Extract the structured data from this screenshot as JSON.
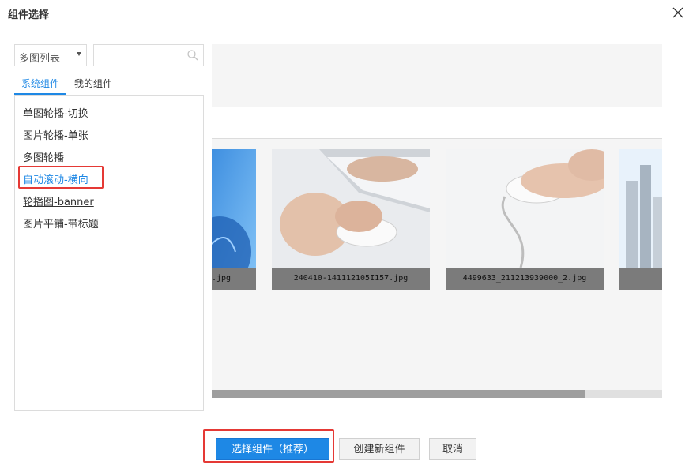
{
  "dialog": {
    "title": "组件选择"
  },
  "filter": {
    "dropdown_value": "多图列表",
    "search_placeholder": ""
  },
  "tabs": [
    {
      "label": "系统组件"
    },
    {
      "label": "我的组件"
    }
  ],
  "components": [
    {
      "label": "单图轮播-切换"
    },
    {
      "label": "图片轮播-单张"
    },
    {
      "label": "多图轮播"
    },
    {
      "label": "自动滚动-横向"
    },
    {
      "label": "轮播图-banner"
    },
    {
      "label": "图片平铺-带标题"
    }
  ],
  "selected_component": "自动滚动-横向",
  "gallery": {
    "images": [
      {
        "caption": ".jpg"
      },
      {
        "caption": "240410-141112105I157.jpg"
      },
      {
        "caption": "4499633_211213939000_2.jpg"
      },
      {
        "caption": ""
      }
    ],
    "scroll_fraction": 0.83
  },
  "buttons": {
    "select_recommended": "选择组件（推荐）",
    "create_new": "创建新组件",
    "cancel": "取消"
  },
  "colors": {
    "accent": "#1e88e5",
    "highlight_border": "#e53935",
    "caption_bg": "#7b7b7b"
  },
  "icons": {
    "close": "close-icon",
    "search": "search-icon",
    "dropdown": "chevron-down-icon"
  }
}
